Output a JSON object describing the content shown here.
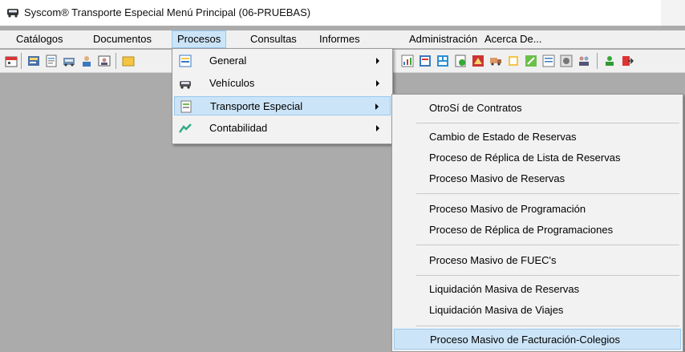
{
  "window": {
    "title": "Syscom® Transporte Especial Menú Principal (06-PRUEBAS)",
    "icon": "bus-icon"
  },
  "menubar": {
    "items": [
      "Catálogos",
      "Documentos",
      "Procesos",
      "Consultas",
      "Informes",
      "Administración",
      "Acerca De..."
    ],
    "active": "Procesos"
  },
  "toolbar": {
    "icons": [
      "calendar-icon",
      "invoice-icon",
      "report-icon",
      "vehicle-card-icon",
      "driver-icon",
      "user-card-icon",
      "folder-icon",
      "chart-icon",
      "schedule-icon",
      "grid-icon",
      "document-icon",
      "route-icon",
      "truck-icon",
      "book-icon",
      "edit-icon",
      "list-icon",
      "settings-icon",
      "people-icon",
      "exit-icon"
    ]
  },
  "procesos_menu": {
    "items": [
      {
        "label": "General",
        "icon": "general-icon",
        "has_submenu": true
      },
      {
        "label": "Vehículos",
        "icon": "car-icon",
        "has_submenu": true
      },
      {
        "label": "Transporte Especial",
        "icon": "transport-icon",
        "has_submenu": true,
        "highlighted": true
      },
      {
        "label": "Contabilidad",
        "icon": "accounting-icon",
        "has_submenu": true
      }
    ]
  },
  "transporte_submenu": {
    "groups": [
      [
        "OtroSí de Contratos"
      ],
      [
        "Cambio de Estado de Reservas",
        "Proceso de Réplica de Lista de Reservas",
        "Proceso Masivo de Reservas"
      ],
      [
        "Proceso Masivo de Programación",
        "Proceso de Réplica de Programaciones"
      ],
      [
        "Proceso Masivo de FUEC's"
      ],
      [
        "Liquidación Masiva de Reservas",
        "Liquidación Masiva de Viajes"
      ],
      [
        "Proceso Masivo de Facturación-Colegios"
      ]
    ],
    "highlighted": "Proceso Masivo de Facturación-Colegios"
  },
  "colors": {
    "menu_highlight": "#cce4f7",
    "menu_highlight_border": "#99c9ef",
    "workspace": "#ababab"
  }
}
